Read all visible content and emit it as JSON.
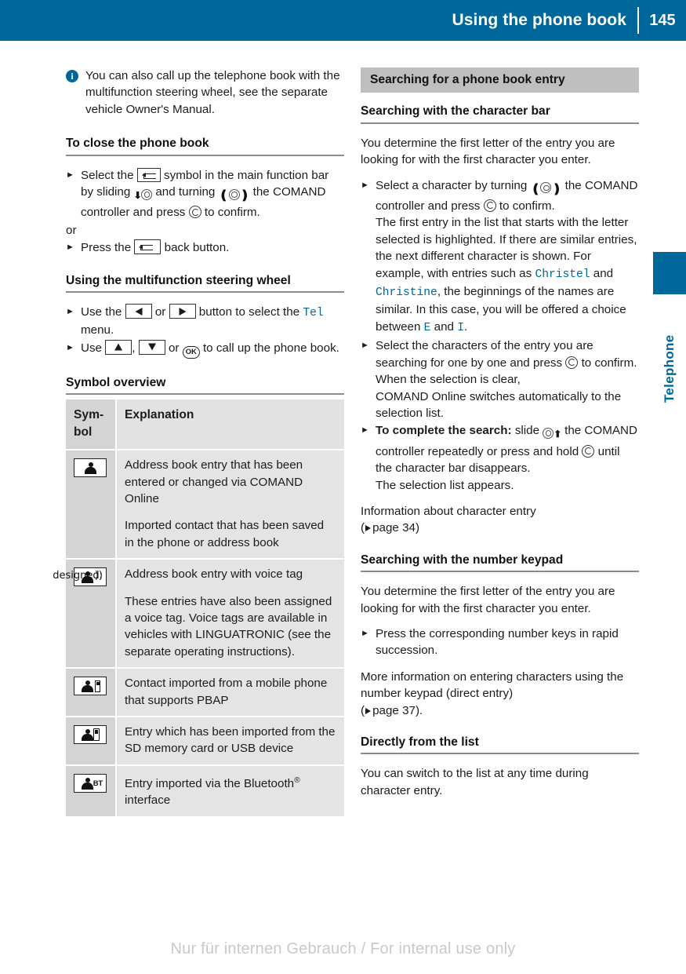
{
  "header": {
    "title": "Using the phone book",
    "page_number": "145"
  },
  "side_tab": {
    "label": "Telephone",
    "accent_color": "#00679a"
  },
  "left_column": {
    "note": {
      "icon": "info-icon",
      "text": "You can also call up the telephone book with the multifunction steering wheel, see the separate vehicle Owner's Manual."
    },
    "close_section": {
      "heading": "To close the phone book",
      "step1_a": "Select the",
      "step1_b": "symbol in the main function bar by sliding",
      "step1_c": "and turning",
      "step1_d": "the COMAND controller and press",
      "step1_e": "to confirm.",
      "or": "or",
      "step2_a": "Press the",
      "step2_b": "back button."
    },
    "mfsw_section": {
      "heading": "Using the multifunction steering wheel",
      "step1_a": "Use the",
      "step1_or": "or",
      "step1_b": "button to select the",
      "step1_menu": "Tel",
      "step1_c": "menu.",
      "step2_a": "Use",
      "step2_comma": ",",
      "step2_or": "or",
      "step2_b": "to call up the phone book."
    },
    "symbol_section": {
      "heading": "Symbol overview",
      "table": {
        "columns": [
          "Sym-\nbol",
          "Explanation"
        ],
        "col1_header": "Sym-",
        "col1_header2": "bol",
        "col2_header": "Explanation",
        "rows": [
          {
            "icon": "contact-person-icon",
            "paragraphs": [
              "Address book entry that has been entered or changed via COMAND Online",
              "Imported contact that has been saved in the phone or address book"
            ]
          },
          {
            "icon": "contact-voice-tag-icon",
            "paragraphs": [
              "Address book entry with voice tag",
              "These entries have also been assigned a voice tag. Voice tags are available in vehicles with LINGUATRONIC (see the separate operating instructions)."
            ]
          },
          {
            "icon": "contact-mobile-phone-icon",
            "paragraphs": [
              "Contact imported from a mobile phone that supports PBAP"
            ]
          },
          {
            "icon": "contact-sd-usb-icon",
            "paragraphs": [
              "Entry which has been imported from the SD memory card or USB device"
            ]
          },
          {
            "icon": "contact-bluetooth-icon",
            "bt_label": "BT",
            "paragraphs_pre": "Entry imported via the Bluetooth",
            "paragraphs_post": " interface"
          }
        ]
      }
    }
  },
  "right_column": {
    "section_header": "Searching for a phone book entry",
    "char_bar": {
      "heading": "Searching with the character bar",
      "intro": "You determine the first letter of the entry you are looking for with the first character you enter.",
      "step1_a": "Select a character by turning",
      "step1_b": "the COMAND controller and press",
      "step1_c": "to confirm.",
      "step1_detail_a": "The first entry in the list that starts with the letter selected is highlighted. If there are similar entries, the next different character is shown. For example, with entries such as",
      "name1": "Christel",
      "and": "and",
      "name2": "Christine",
      "step1_detail_b": ", the beginnings of the names are similar. In this case, you will be offered a choice between",
      "letter1": "E",
      "and2": "and",
      "letter2": "I",
      "period": ".",
      "step2_a": "Select the characters of the entry you are searching for one by one and press",
      "step2_b": "to confirm.",
      "step2_detail": "When the selection is clear,\nCOMAND Online switches automatically to the selection list.",
      "step2_detail_1": "When the selection is clear,",
      "step2_detail_2": "COMAND Online switches automatically to the selection list.",
      "step3_bold": "To complete the search:",
      "step3_a": "slide",
      "step3_b": "the COMAND controller repeatedly or press and hold",
      "step3_c": "until the character bar disappears.",
      "step3_detail": "The selection list appears.",
      "info_a": "Information about character entry",
      "info_ref": "page 34"
    },
    "number_keypad": {
      "heading": "Searching with the number keypad",
      "intro": "You determine the first letter of the entry you are looking for with the first character you enter.",
      "step1": "Press the corresponding number keys in rapid succession.",
      "more_a": "More information on entering characters using the number keypad (direct entry)",
      "more_ref": "page 37",
      "more_b": ")."
    },
    "from_list": {
      "heading": "Directly from the list",
      "text": "You can switch to the list at any time during character entry."
    }
  },
  "footer": {
    "watermark": "Nur für internen Gebrauch / For internal use only"
  }
}
